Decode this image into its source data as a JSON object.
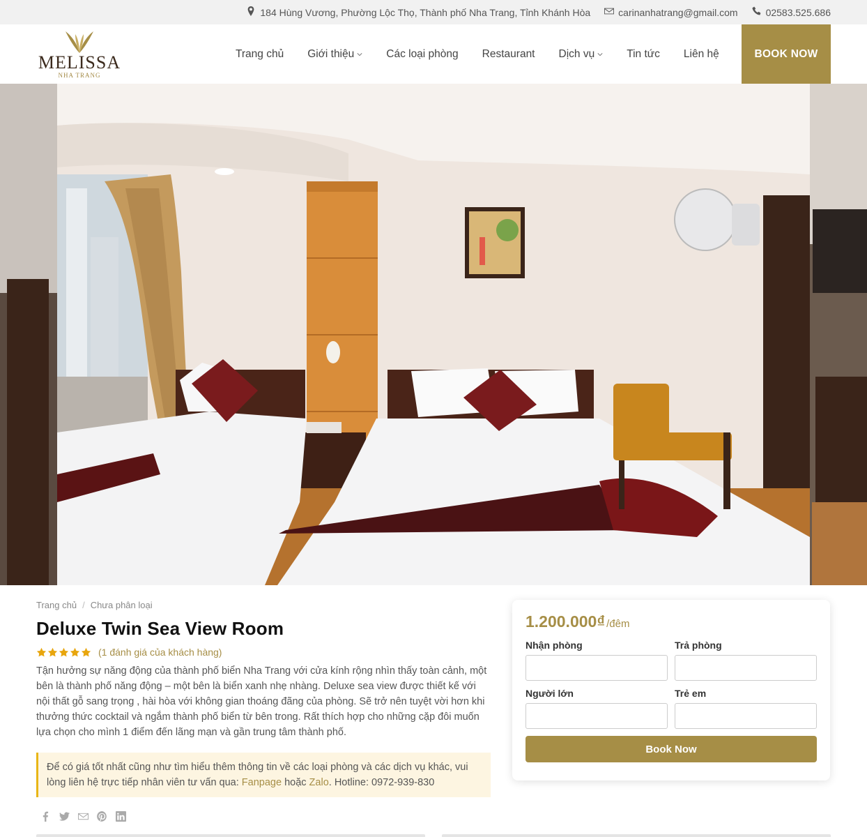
{
  "topbar": {
    "address": "184 Hùng Vương, Phường Lộc Thọ, Thành phố Nha Trang, Tỉnh Khánh Hòa",
    "email": "carinanhatrang@gmail.com",
    "phone": "02583.525.686"
  },
  "logo": {
    "brand": "MELISSA",
    "sub": "NHA TRANG"
  },
  "nav": {
    "items": [
      {
        "label": "Trang chủ",
        "has_dropdown": false
      },
      {
        "label": "Giới thiệu",
        "has_dropdown": true
      },
      {
        "label": "Các loại phòng",
        "has_dropdown": false
      },
      {
        "label": "Restaurant",
        "has_dropdown": false
      },
      {
        "label": "Dịch vụ",
        "has_dropdown": true
      },
      {
        "label": "Tin tức",
        "has_dropdown": false
      },
      {
        "label": "Liên hệ",
        "has_dropdown": false
      }
    ],
    "book_now": "BOOK NOW"
  },
  "breadcrumb": {
    "home": "Trang chủ",
    "separator": "/",
    "category": "Chưa phân loại"
  },
  "room": {
    "title": "Deluxe Twin Sea View Room",
    "rating_stars": 5,
    "rating_text": "(1 đánh giá của khách hàng)",
    "description": "Tận hưởng sự năng động của thành phố biển Nha Trang với cửa kính rộng nhìn thấy toàn cảnh, một bên là thành phố năng động – một bên là biển xanh nhẹ nhàng. Deluxe sea view được thiết kế với nội thất gỗ sang trọng , hài hòa với không gian thoáng đãng của phòng. Sẽ trở nên tuyệt vời hơn khi thưởng thức cocktail và ngắm thành phố biển từ bên trong. Rất thích hợp cho những cặp đôi muốn lựa chọn cho mình 1 điểm đến lãng mạn và gần trung tâm thành phố."
  },
  "notice": {
    "text_before": "Để có giá tốt nhất cũng như tìm hiểu thêm thông tin về các loại phòng và các dịch vụ khác, vui lòng liên hệ trực tiếp nhân viên tư vấn qua: ",
    "fanpage": "Fanpage",
    "middle": " hoặc ",
    "zalo": "Zalo",
    "after": ". Hotline: 0972-939-830"
  },
  "booking": {
    "price": "1.200.000₫",
    "per": "/đêm",
    "checkin_label": "Nhận phòng",
    "checkout_label": "Trả phòng",
    "adults_label": "Người lớn",
    "children_label": "Trẻ em",
    "checkin_value": "",
    "checkout_value": "",
    "adults_value": "",
    "children_value": "",
    "button": "Book Now"
  },
  "share_icons": [
    "facebook-icon",
    "twitter-icon",
    "email-icon",
    "pinterest-icon",
    "linkedin-icon"
  ],
  "colors": {
    "accent": "#a68e46",
    "notice_bg": "#fdf5e1",
    "notice_border": "#e9b616",
    "star": "#e8a60e"
  }
}
